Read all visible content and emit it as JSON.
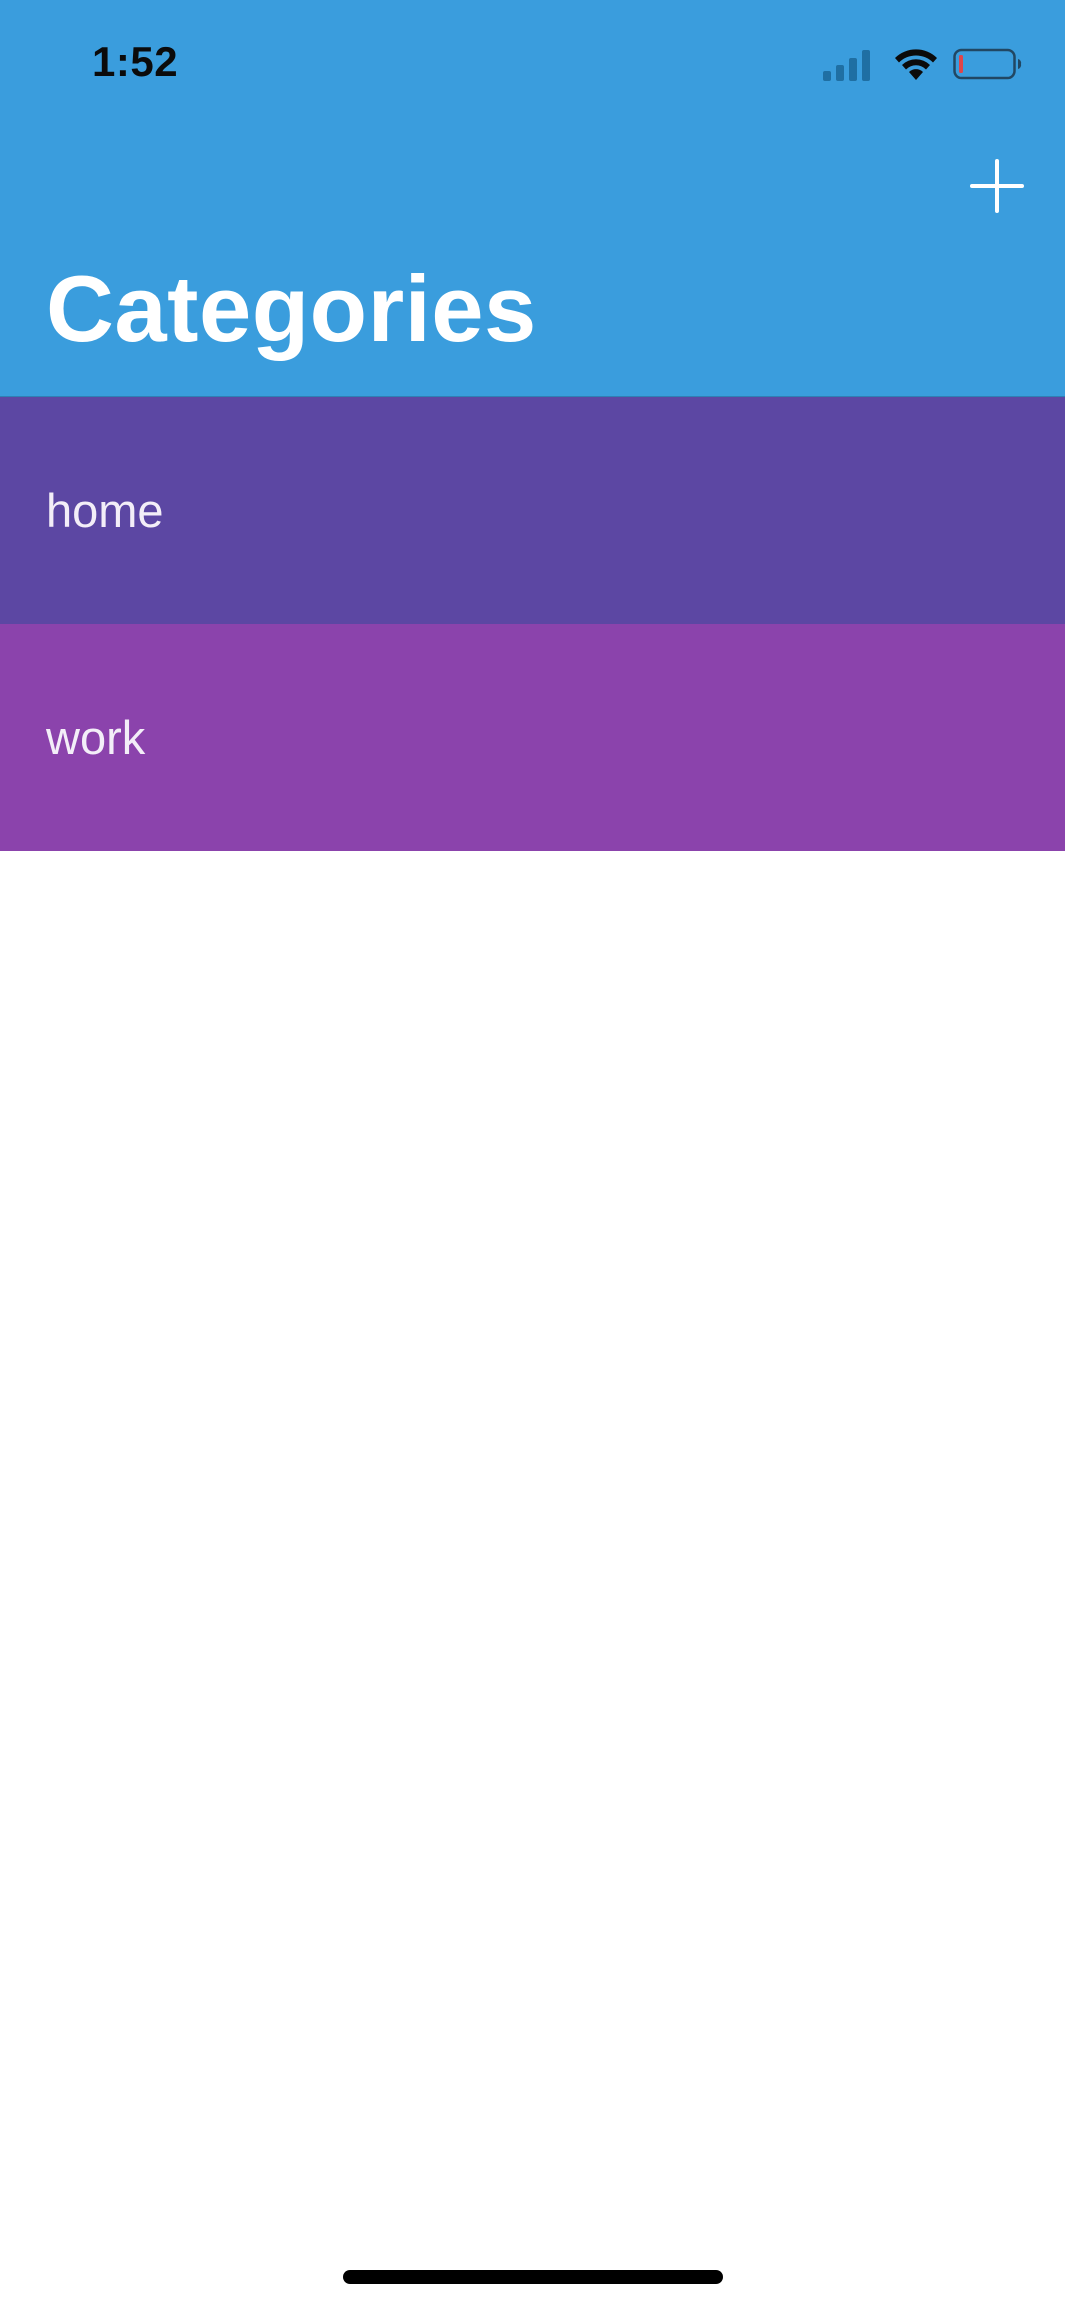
{
  "status_bar": {
    "time": "1:52",
    "icons": {
      "signal": "cellular-signal-icon",
      "wifi": "wifi-icon",
      "battery": "battery-low-icon"
    }
  },
  "nav": {
    "title": "Categories",
    "add_icon": "plus-icon"
  },
  "colors": {
    "header": "#3a9ddd",
    "list_item_home": "#5c47a3",
    "list_item_work": "#8b43ac",
    "battery_low": "#e0454a"
  },
  "categories": [
    {
      "label": "home",
      "color": "#5c47a3"
    },
    {
      "label": "work",
      "color": "#8b43ac"
    }
  ]
}
